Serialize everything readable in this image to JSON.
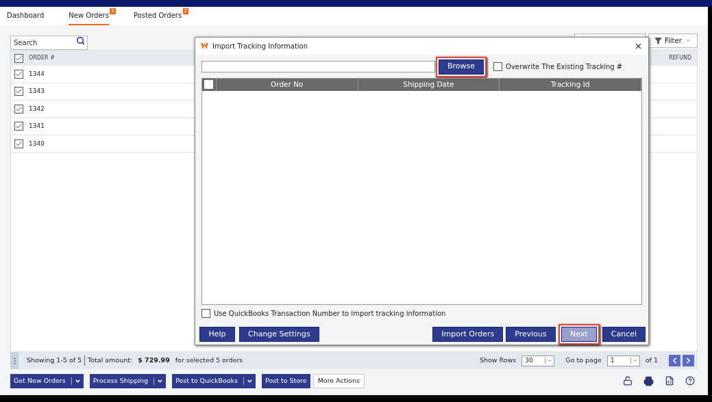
{
  "tabs": [
    {
      "label": "Dashboard",
      "selected": false
    },
    {
      "label": "New Orders",
      "badge": "5",
      "selected": true
    },
    {
      "label": "Posted Orders",
      "badge": "2",
      "selected": false
    }
  ],
  "search": {
    "placeholder": "Search"
  },
  "filter": {
    "label": "Filter"
  },
  "table": {
    "header_checked": true,
    "columns": [
      "ORDER #",
      "REFUND"
    ],
    "rows": [
      {
        "order": "1344",
        "checked": true
      },
      {
        "order": "1343",
        "checked": true
      },
      {
        "order": "1342",
        "checked": true
      },
      {
        "order": "1341",
        "checked": true
      },
      {
        "order": "1340",
        "checked": true
      }
    ]
  },
  "dialog": {
    "title": "Import Tracking Information",
    "browse": {
      "label": "Browse",
      "highlighted": true
    },
    "overwrite": {
      "label": "Overwrite The Existing Tracking #",
      "checked": false
    },
    "grid": {
      "header_checked": false,
      "columns": [
        "Order No",
        "Shipping Date",
        "Tracking Id"
      ]
    },
    "use_qb": {
      "label": "Use QuickBooks Transaction Number to import tracking information",
      "checked": false
    },
    "left_buttons": [
      {
        "label": "Help",
        "disabled": false,
        "highlighted": false
      },
      {
        "label": "Change Settings",
        "disabled": false,
        "highlighted": false
      }
    ],
    "right_buttons": [
      {
        "label": "Import Orders",
        "disabled": false,
        "highlighted": false
      },
      {
        "label": "Previous",
        "disabled": false,
        "highlighted": false
      },
      {
        "label": "Next",
        "disabled": true,
        "highlighted": true
      },
      {
        "label": "Cancel",
        "disabled": false,
        "highlighted": false
      }
    ]
  },
  "status": {
    "showing": "Showing 1-5 of 5",
    "total_label": "Total amount:",
    "total": "$ 729.99",
    "suffix": "for selected 5 orders"
  },
  "pager": {
    "show_rows_label": "Show Rows",
    "show_rows": "30",
    "go_to_label": "Go to page",
    "page": "1",
    "of": "of 1"
  },
  "actions": [
    {
      "label": "Get New Orders",
      "kind": "split"
    },
    {
      "label": "Process Shipping",
      "kind": "split"
    },
    {
      "label": "Post to QuickBooks",
      "kind": "split"
    },
    {
      "label": "Post to Store",
      "kind": "primary"
    },
    {
      "label": "More Actions",
      "kind": "plain"
    }
  ]
}
